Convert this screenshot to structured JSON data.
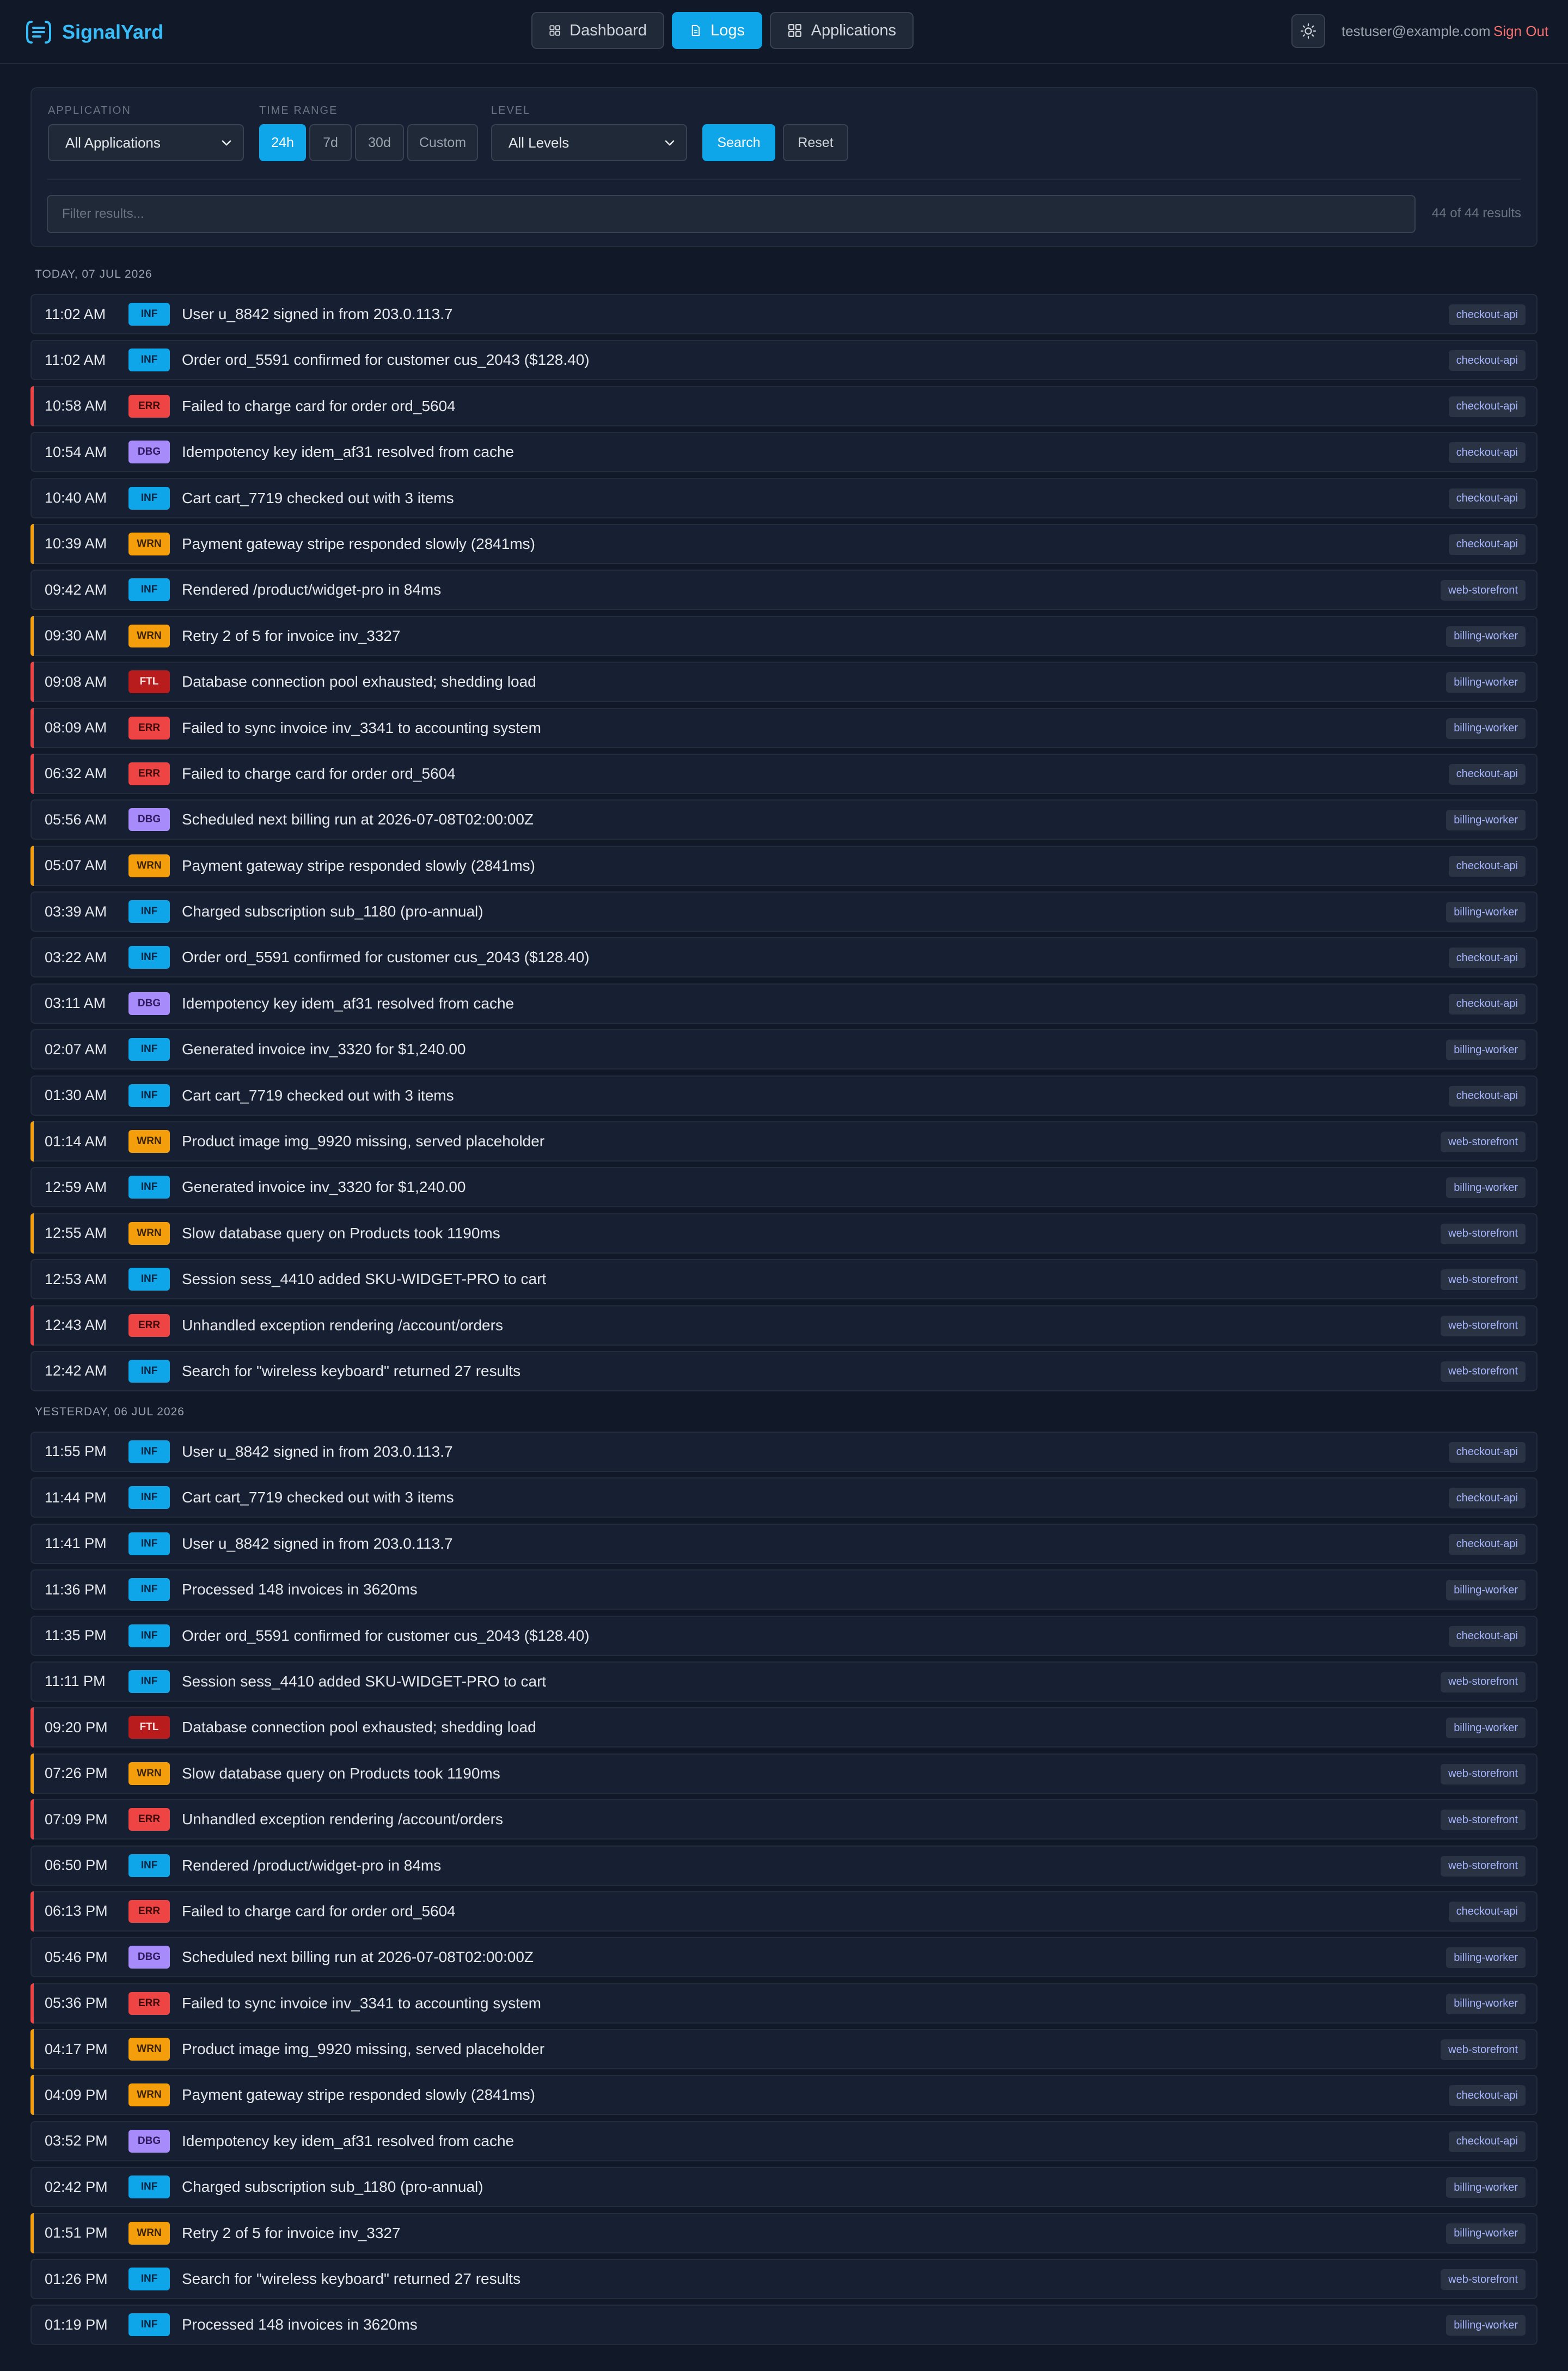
{
  "brand": {
    "name": "SignalYard"
  },
  "nav": {
    "items": [
      {
        "label": "Dashboard",
        "icon": "grid-icon"
      },
      {
        "label": "Logs",
        "icon": "document-icon",
        "active": true
      },
      {
        "label": "Applications",
        "icon": "grid-icon"
      }
    ]
  },
  "user": {
    "email": "testuser@example.com",
    "sign_out": "Sign Out"
  },
  "filters": {
    "application_label": "APPLICATION",
    "application_value": "All Applications",
    "time_range_label": "TIME RANGE",
    "time_ranges": [
      "24h",
      "7d",
      "30d",
      "Custom"
    ],
    "time_range_selected": "24h",
    "level_label": "LEVEL",
    "level_value": "All Levels",
    "search_label": "Search",
    "reset_label": "Reset",
    "filter_placeholder": "Filter results...",
    "result_count": "44 of 44 results"
  },
  "colors": {
    "accent": "#0ea5e9",
    "INF": "#0ea5e9",
    "ERR": "#ef4444",
    "WRN": "#f59e0b",
    "DBG": "#a78bfa",
    "FTL": "#b91c1c"
  },
  "groups": [
    {
      "header": "TODAY, 07 JUL 2026",
      "rows": [
        {
          "time": "11:02 AM",
          "level": "INF",
          "message": "User u_8842 signed in from 203.0.113.7",
          "app": "checkout-api"
        },
        {
          "time": "11:02 AM",
          "level": "INF",
          "message": "Order ord_5591 confirmed for customer cus_2043 ($128.40)",
          "app": "checkout-api"
        },
        {
          "time": "10:58 AM",
          "level": "ERR",
          "message": "Failed to charge card for order ord_5604",
          "app": "checkout-api"
        },
        {
          "time": "10:54 AM",
          "level": "DBG",
          "message": "Idempotency key idem_af31 resolved from cache",
          "app": "checkout-api"
        },
        {
          "time": "10:40 AM",
          "level": "INF",
          "message": "Cart cart_7719 checked out with 3 items",
          "app": "checkout-api"
        },
        {
          "time": "10:39 AM",
          "level": "WRN",
          "message": "Payment gateway stripe responded slowly (2841ms)",
          "app": "checkout-api"
        },
        {
          "time": "09:42 AM",
          "level": "INF",
          "message": "Rendered /product/widget-pro in 84ms",
          "app": "web-storefront"
        },
        {
          "time": "09:30 AM",
          "level": "WRN",
          "message": "Retry 2 of 5 for invoice inv_3327",
          "app": "billing-worker"
        },
        {
          "time": "09:08 AM",
          "level": "FTL",
          "message": "Database connection pool exhausted; shedding load",
          "app": "billing-worker"
        },
        {
          "time": "08:09 AM",
          "level": "ERR",
          "message": "Failed to sync invoice inv_3341 to accounting system",
          "app": "billing-worker"
        },
        {
          "time": "06:32 AM",
          "level": "ERR",
          "message": "Failed to charge card for order ord_5604",
          "app": "checkout-api"
        },
        {
          "time": "05:56 AM",
          "level": "DBG",
          "message": "Scheduled next billing run at 2026-07-08T02:00:00Z",
          "app": "billing-worker"
        },
        {
          "time": "05:07 AM",
          "level": "WRN",
          "message": "Payment gateway stripe responded slowly (2841ms)",
          "app": "checkout-api"
        },
        {
          "time": "03:39 AM",
          "level": "INF",
          "message": "Charged subscription sub_1180 (pro-annual)",
          "app": "billing-worker"
        },
        {
          "time": "03:22 AM",
          "level": "INF",
          "message": "Order ord_5591 confirmed for customer cus_2043 ($128.40)",
          "app": "checkout-api"
        },
        {
          "time": "03:11 AM",
          "level": "DBG",
          "message": "Idempotency key idem_af31 resolved from cache",
          "app": "checkout-api"
        },
        {
          "time": "02:07 AM",
          "level": "INF",
          "message": "Generated invoice inv_3320 for $1,240.00",
          "app": "billing-worker"
        },
        {
          "time": "01:30 AM",
          "level": "INF",
          "message": "Cart cart_7719 checked out with 3 items",
          "app": "checkout-api"
        },
        {
          "time": "01:14 AM",
          "level": "WRN",
          "message": "Product image img_9920 missing, served placeholder",
          "app": "web-storefront"
        },
        {
          "time": "12:59 AM",
          "level": "INF",
          "message": "Generated invoice inv_3320 for $1,240.00",
          "app": "billing-worker"
        },
        {
          "time": "12:55 AM",
          "level": "WRN",
          "message": "Slow database query on Products took 1190ms",
          "app": "web-storefront"
        },
        {
          "time": "12:53 AM",
          "level": "INF",
          "message": "Session sess_4410 added SKU-WIDGET-PRO to cart",
          "app": "web-storefront"
        },
        {
          "time": "12:43 AM",
          "level": "ERR",
          "message": "Unhandled exception rendering /account/orders",
          "app": "web-storefront"
        },
        {
          "time": "12:42 AM",
          "level": "INF",
          "message": "Search for \"wireless keyboard\" returned 27 results",
          "app": "web-storefront"
        }
      ]
    },
    {
      "header": "YESTERDAY, 06 JUL 2026",
      "rows": [
        {
          "time": "11:55 PM",
          "level": "INF",
          "message": "User u_8842 signed in from 203.0.113.7",
          "app": "checkout-api"
        },
        {
          "time": "11:44 PM",
          "level": "INF",
          "message": "Cart cart_7719 checked out with 3 items",
          "app": "checkout-api"
        },
        {
          "time": "11:41 PM",
          "level": "INF",
          "message": "User u_8842 signed in from 203.0.113.7",
          "app": "checkout-api"
        },
        {
          "time": "11:36 PM",
          "level": "INF",
          "message": "Processed 148 invoices in 3620ms",
          "app": "billing-worker"
        },
        {
          "time": "11:35 PM",
          "level": "INF",
          "message": "Order ord_5591 confirmed for customer cus_2043 ($128.40)",
          "app": "checkout-api"
        },
        {
          "time": "11:11 PM",
          "level": "INF",
          "message": "Session sess_4410 added SKU-WIDGET-PRO to cart",
          "app": "web-storefront"
        },
        {
          "time": "09:20 PM",
          "level": "FTL",
          "message": "Database connection pool exhausted; shedding load",
          "app": "billing-worker"
        },
        {
          "time": "07:26 PM",
          "level": "WRN",
          "message": "Slow database query on Products took 1190ms",
          "app": "web-storefront"
        },
        {
          "time": "07:09 PM",
          "level": "ERR",
          "message": "Unhandled exception rendering /account/orders",
          "app": "web-storefront"
        },
        {
          "time": "06:50 PM",
          "level": "INF",
          "message": "Rendered /product/widget-pro in 84ms",
          "app": "web-storefront"
        },
        {
          "time": "06:13 PM",
          "level": "ERR",
          "message": "Failed to charge card for order ord_5604",
          "app": "checkout-api"
        },
        {
          "time": "05:46 PM",
          "level": "DBG",
          "message": "Scheduled next billing run at 2026-07-08T02:00:00Z",
          "app": "billing-worker"
        },
        {
          "time": "05:36 PM",
          "level": "ERR",
          "message": "Failed to sync invoice inv_3341 to accounting system",
          "app": "billing-worker"
        },
        {
          "time": "04:17 PM",
          "level": "WRN",
          "message": "Product image img_9920 missing, served placeholder",
          "app": "web-storefront"
        },
        {
          "time": "04:09 PM",
          "level": "WRN",
          "message": "Payment gateway stripe responded slowly (2841ms)",
          "app": "checkout-api"
        },
        {
          "time": "03:52 PM",
          "level": "DBG",
          "message": "Idempotency key idem_af31 resolved from cache",
          "app": "checkout-api"
        },
        {
          "time": "02:42 PM",
          "level": "INF",
          "message": "Charged subscription sub_1180 (pro-annual)",
          "app": "billing-worker"
        },
        {
          "time": "01:51 PM",
          "level": "WRN",
          "message": "Retry 2 of 5 for invoice inv_3327",
          "app": "billing-worker"
        },
        {
          "time": "01:26 PM",
          "level": "INF",
          "message": "Search for \"wireless keyboard\" returned 27 results",
          "app": "web-storefront"
        },
        {
          "time": "01:19 PM",
          "level": "INF",
          "message": "Processed 148 invoices in 3620ms",
          "app": "billing-worker"
        }
      ]
    }
  ]
}
